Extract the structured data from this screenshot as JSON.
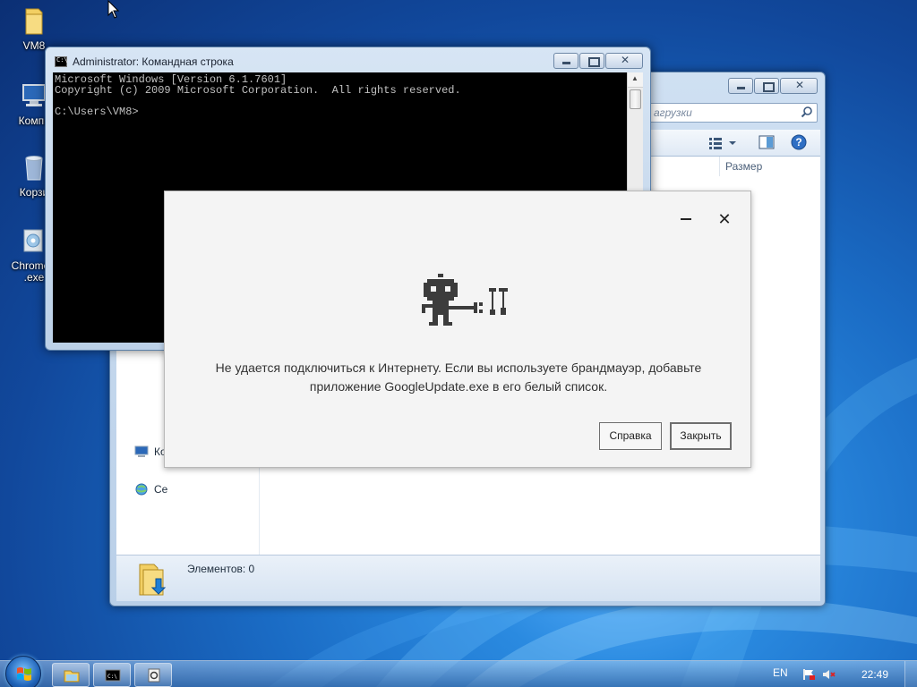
{
  "desktop": {
    "icons": [
      {
        "label": "VM8",
        "icon": "folder-icon"
      },
      {
        "label": "Компь",
        "icon": "computer-icon"
      },
      {
        "label": "Корзи",
        "icon": "recycle-bin-icon"
      },
      {
        "label": "ChromeS",
        "label2": ".exe",
        "icon": "installer-icon"
      }
    ]
  },
  "explorer": {
    "search_placeholder": "агрузки",
    "column_size": "Размер",
    "nav_items": [
      {
        "label": "Ко",
        "icon": "computer-icon"
      },
      {
        "label": "Се",
        "icon": "network-icon"
      }
    ],
    "status_text": "Элементов: 0"
  },
  "cmd": {
    "title": "Administrator: Командная строка",
    "lines": [
      "Microsoft Windows [Version 6.1.7601]",
      "Copyright (c) 2009 Microsoft Corporation.  All rights reserved.",
      "",
      "C:\\Users\\VM8>"
    ]
  },
  "google_update": {
    "message_line1": "Не удается подключиться к Интернету. Если вы используете брандмауэр, добавьте",
    "message_line2": "приложение GoogleUpdate.exe в его белый список.",
    "help_button": "Справка",
    "close_button": "Закрыть",
    "close_glyph": "✕"
  },
  "taskbar": {
    "language": "EN",
    "clock": "22:49",
    "buttons": [
      "explorer-icon",
      "cmd-icon",
      "google-update-icon"
    ]
  },
  "colors": {
    "desktop_bg": "#1a6bc4",
    "dialog_bg": "#f4f4f4",
    "robot": "#3c3c3c"
  }
}
